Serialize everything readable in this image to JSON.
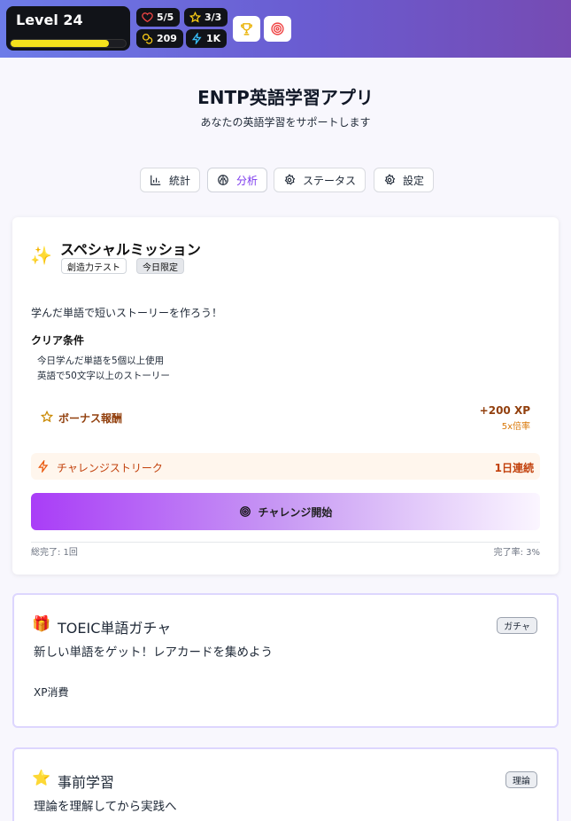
{
  "header": {
    "level_label": "Level 24",
    "xp_progress": 0.85,
    "hearts": "5/5",
    "stars": "3/3",
    "coins": "209",
    "energy": "1K",
    "trophy_icon": "trophy-icon",
    "target_icon": "target-icon"
  },
  "app": {
    "title": "ENTP英語学習アプリ",
    "subtitle": "あなたの英語学習をサポートします"
  },
  "nav": {
    "tabs": [
      {
        "label": "統計",
        "icon": "bar-chart-icon"
      },
      {
        "label": "分析",
        "icon": "brain-icon",
        "active": true
      },
      {
        "label": "ステータス",
        "icon": "gear-icon"
      },
      {
        "label": "設定",
        "icon": "gear-icon"
      }
    ]
  },
  "mission": {
    "title": "スペシャルミッション",
    "tags": [
      "創造力テスト",
      "今日限定"
    ],
    "description": "学んだ単語で短いストーリーを作ろう！",
    "conditions_title": "クリア条件",
    "conditions": [
      "今日学んだ単語を5個以上使用",
      "英語で50文字以上のストーリー"
    ],
    "bonus_label": "ボーナス報酬",
    "bonus_xp": "+200 XP",
    "bonus_multiplier": "5x倍率",
    "streak_label": "チャレンジストリーク",
    "streak_value": "1日連続",
    "start_button": "チャレンジ開始",
    "total_completed": "総完了: 1回",
    "completion_rate": "完了率: 3%"
  },
  "cards": [
    {
      "emoji": "🎁",
      "title": "TOEIC単語ガチャ",
      "tag": "ガチャ",
      "description": "新しい単語をゲット！レアカードを集めよう",
      "extra": "XP消費"
    },
    {
      "emoji": "⭐",
      "title": "事前学習",
      "tag": "理論",
      "description": "理論を理解してから実践へ"
    }
  ],
  "colors": {
    "accent": "#7c3aed",
    "header_gradient_start": "#6d7ce8",
    "header_gradient_end": "#764bb3",
    "bonus": "#92400e",
    "streak": "#c2410c",
    "xp_bar": "#f5e21c"
  }
}
